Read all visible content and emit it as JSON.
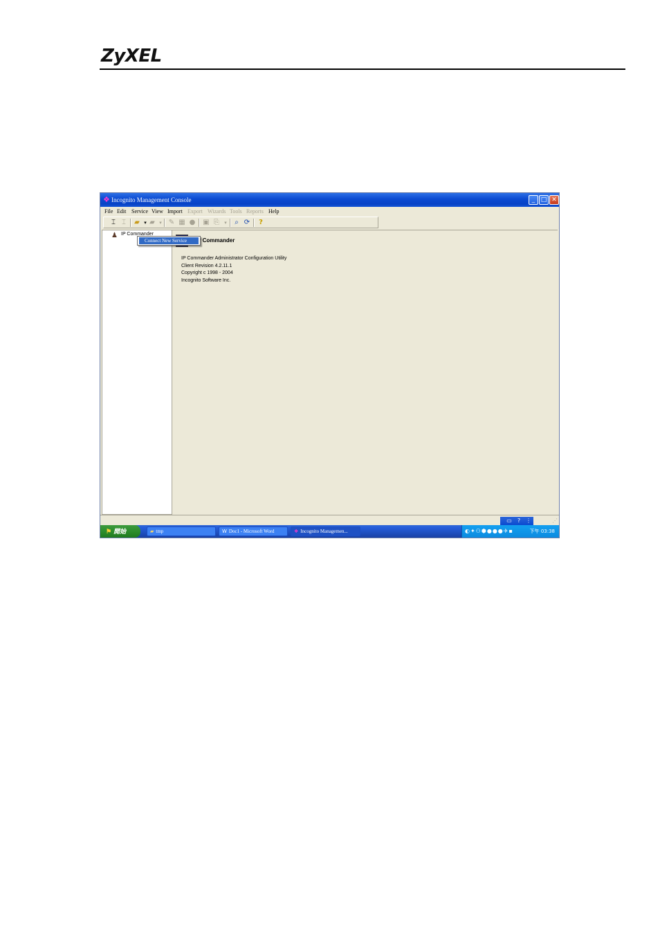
{
  "document": {
    "brand": "ZyXEL"
  },
  "window": {
    "title": "Incognito Management Console",
    "buttons": {
      "minimize": "_",
      "maximize": "□",
      "close": "✕"
    }
  },
  "menu": {
    "items": [
      "File",
      "Edit",
      "Service",
      "View",
      "Import",
      "Export",
      "Wizards",
      "Tools",
      "Reports",
      "Help"
    ],
    "disabled": [
      "Export",
      "Wizards",
      "Tools",
      "Reports"
    ]
  },
  "tree": {
    "root_label": "IP Commander",
    "context_menu": {
      "item": "Connect New Service"
    }
  },
  "about": {
    "name": "IP Commander",
    "lines": [
      "IP Commander Administrator Configuration Utility",
      "Client Revision 4.2.11.1",
      "Copyright c 1998 - 2004",
      "Incognito Software Inc."
    ]
  },
  "taskbar": {
    "start_label": "開始",
    "tasks": [
      {
        "label": "tmp",
        "icon": "folder-icon"
      },
      {
        "label": "Doc1 - Microsoft Word",
        "icon": "word-icon"
      },
      {
        "label": "Incognito Managemen...",
        "icon": "incognito-icon",
        "active": true
      }
    ],
    "clock": "下午 03:38"
  },
  "colors": {
    "titlebar": "#0a4ad1",
    "window_bg": "#ece9d8",
    "selection": "#316ac5",
    "start_green": "#2a8a2a"
  }
}
